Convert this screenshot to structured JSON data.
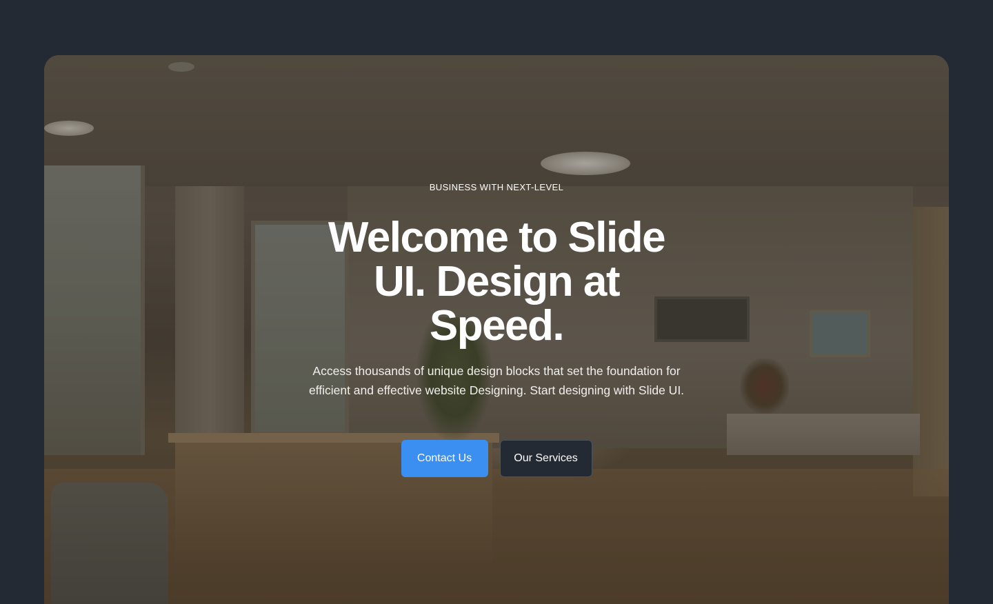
{
  "hero": {
    "eyebrow": "BUSINESS WITH NEXT-LEVEL",
    "title": "Welcome to Slide UI. Design at Speed.",
    "description": "Access thousands of unique design blocks that set the foundation for efficient and effective website Designing. Start designing with Slide UI.",
    "background_image": "office-lobby-photo"
  },
  "buttons": {
    "primary_label": "Contact Us",
    "secondary_label": "Our Services"
  },
  "colors": {
    "page_background": "#232a33",
    "primary_button": "#3b8ff0",
    "secondary_button": "#232a33",
    "text": "#ffffff"
  }
}
